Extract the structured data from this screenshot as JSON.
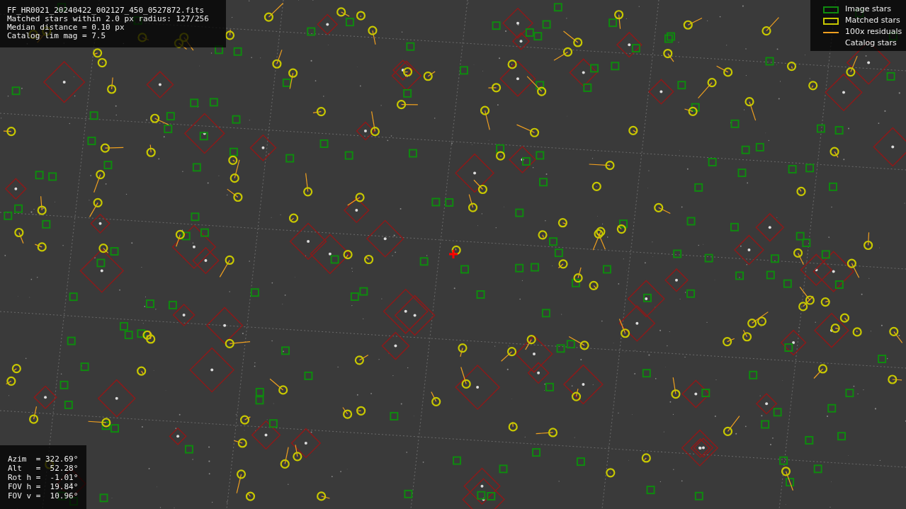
{
  "info_lines": [
    "FF_HR0021_20240422_002127_450_0527872.fits",
    "Matched stars within 2.0 px radius: 127/256",
    "Median distance = 0.10 px",
    "Catalog lim mag = 7.5"
  ],
  "legend": [
    {
      "kind": "image",
      "label": "Image stars"
    },
    {
      "kind": "matched",
      "label": "Matched stars"
    },
    {
      "kind": "residual",
      "label": "100x residuals"
    },
    {
      "kind": "catalog",
      "label": "Catalog stars"
    }
  ],
  "pointing_lines": [
    "Azim  = 322.69°",
    "Alt   =  52.28°",
    "Rot h =  -1.01°",
    "FOV h =  19.84°",
    "FOV v =  10.96°"
  ]
}
